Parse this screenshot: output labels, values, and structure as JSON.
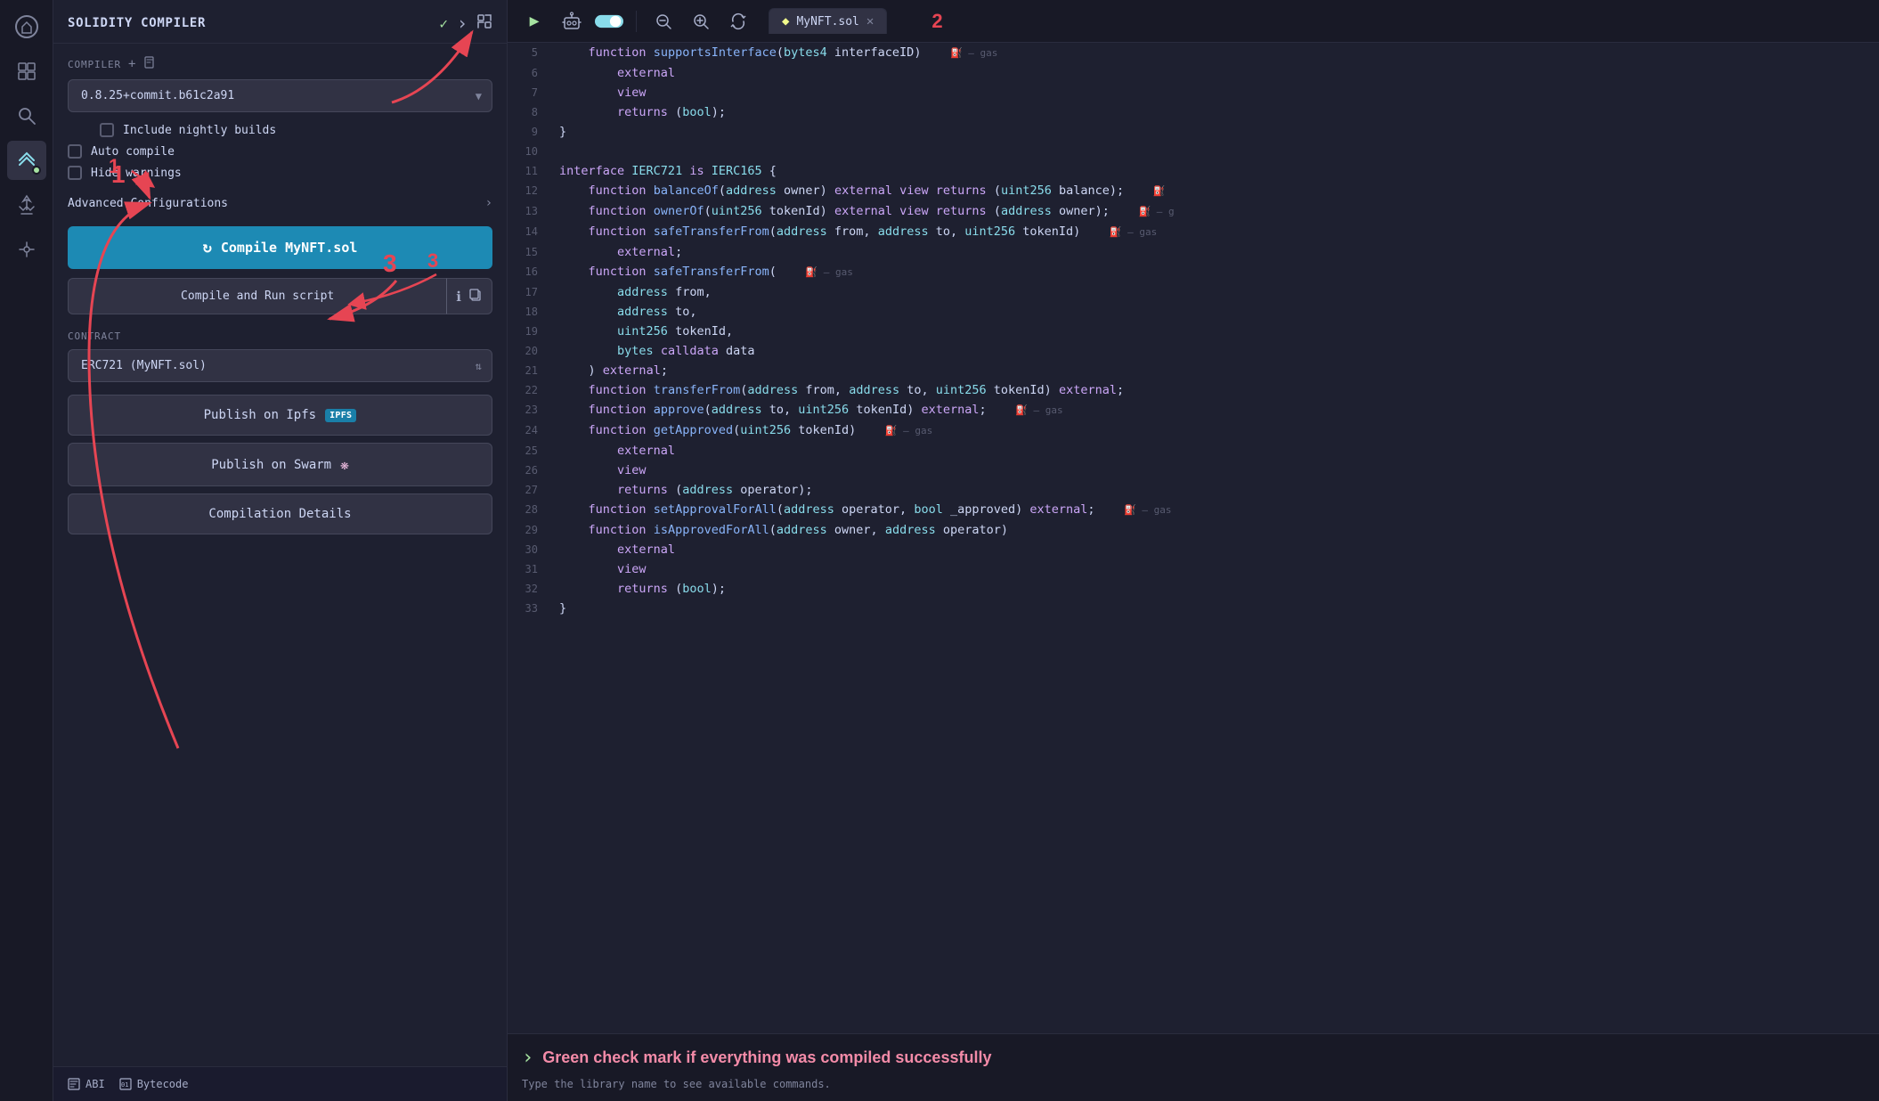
{
  "app": {
    "title": "SOLIDITY COMPILER"
  },
  "iconbar": {
    "items": [
      {
        "name": "home-icon",
        "symbol": "⬡",
        "active": false
      },
      {
        "name": "copy-icon",
        "symbol": "⧉",
        "active": false
      },
      {
        "name": "search-icon",
        "symbol": "🔍",
        "active": false
      },
      {
        "name": "compiler-icon",
        "symbol": "◈",
        "active": true
      },
      {
        "name": "deploy-icon",
        "symbol": "✦",
        "active": false
      },
      {
        "name": "plugin-icon",
        "symbol": "⚙",
        "active": false
      }
    ]
  },
  "sidebar": {
    "title": "SOLIDITY COMPILER",
    "header_icons": {
      "check": "✓",
      "forward": "›",
      "expand": "⤢"
    },
    "compiler_section_label": "COMPILER",
    "add_icon": "+",
    "file_icon": "⊡",
    "compiler_version": "0.8.25+commit.b61c2a91",
    "nightly_builds_label": "Include nightly builds",
    "auto_compile_label": "Auto compile",
    "hide_warnings_label": "Hide warnings",
    "advanced_config_label": "Advanced Configurations",
    "compile_btn_label": "Compile MyNFT.sol",
    "compile_run_label": "Compile and Run script",
    "contract_label": "CONTRACT",
    "contract_value": "ERC721 (MyNFT.sol)",
    "publish_ipfs_label": "Publish on Ipfs",
    "ipfs_badge": "IPFS",
    "publish_swarm_label": "Publish on Swarm",
    "compilation_details_label": "Compilation Details",
    "abi_label": "ABI",
    "bytecode_label": "Bytecode"
  },
  "annotations": {
    "one": "1",
    "two": "2",
    "three": "3"
  },
  "editor": {
    "tab_name": "MyNFT.sol",
    "lines": [
      {
        "num": "5",
        "content": "    function supportsInterface(bytes4 interfaceID)",
        "type": "code",
        "gas": "⛽ – gas"
      },
      {
        "num": "6",
        "content": "        external",
        "type": "code"
      },
      {
        "num": "7",
        "content": "        view",
        "type": "code"
      },
      {
        "num": "8",
        "content": "        returns (bool);",
        "type": "code"
      },
      {
        "num": "9",
        "content": "}",
        "type": "code"
      },
      {
        "num": "10",
        "content": "",
        "type": "empty"
      },
      {
        "num": "11",
        "content": "interface IERC721 is IERC165 {",
        "type": "code"
      },
      {
        "num": "12",
        "content": "    function balanceOf(address owner) external view returns (uint256 balance);",
        "type": "code",
        "gas": "⛽"
      },
      {
        "num": "13",
        "content": "    function ownerOf(uint256 tokenId) external view returns (address owner);",
        "type": "code",
        "gas": "⛽ – g"
      },
      {
        "num": "14",
        "content": "    function safeTransferFrom(address from, address to, uint256 tokenId)",
        "type": "code",
        "gas": "⛽ – gas"
      },
      {
        "num": "15",
        "content": "        external;",
        "type": "code"
      },
      {
        "num": "16",
        "content": "    function safeTransferFrom(",
        "type": "code",
        "gas": "⛽ – gas"
      },
      {
        "num": "17",
        "content": "        address from,",
        "type": "code"
      },
      {
        "num": "18",
        "content": "        address to,",
        "type": "code"
      },
      {
        "num": "19",
        "content": "        uint256 tokenId,",
        "type": "code"
      },
      {
        "num": "20",
        "content": "        bytes calldata data",
        "type": "code"
      },
      {
        "num": "21",
        "content": "    ) external;",
        "type": "code"
      },
      {
        "num": "22",
        "content": "    function transferFrom(address from, address to, uint256 tokenId) external;",
        "type": "code"
      },
      {
        "num": "23",
        "content": "    function approve(address to, uint256 tokenId) external;",
        "type": "code",
        "gas": "⛽ – gas"
      },
      {
        "num": "24",
        "content": "    function getApproved(uint256 tokenId)",
        "type": "code",
        "gas": "⛽ – gas"
      },
      {
        "num": "25",
        "content": "        external",
        "type": "code"
      },
      {
        "num": "26",
        "content": "        view",
        "type": "code"
      },
      {
        "num": "27",
        "content": "        returns (address operator);",
        "type": "code"
      },
      {
        "num": "28",
        "content": "    function setApprovalForAll(address operator, bool _approved) external;",
        "type": "code",
        "gas": "⛽ – gas"
      },
      {
        "num": "29",
        "content": "    function isApprovedForAll(address owner, address operator)",
        "type": "code"
      },
      {
        "num": "30",
        "content": "        external",
        "type": "code"
      },
      {
        "num": "31",
        "content": "        view",
        "type": "code"
      },
      {
        "num": "32",
        "content": "        returns (bool);",
        "type": "code"
      },
      {
        "num": "33",
        "content": "}",
        "type": "code"
      }
    ]
  },
  "bottom": {
    "success_text": "Green check mark if everything was compiled successfully",
    "cmd_hint": "Type the library name to see available commands."
  }
}
